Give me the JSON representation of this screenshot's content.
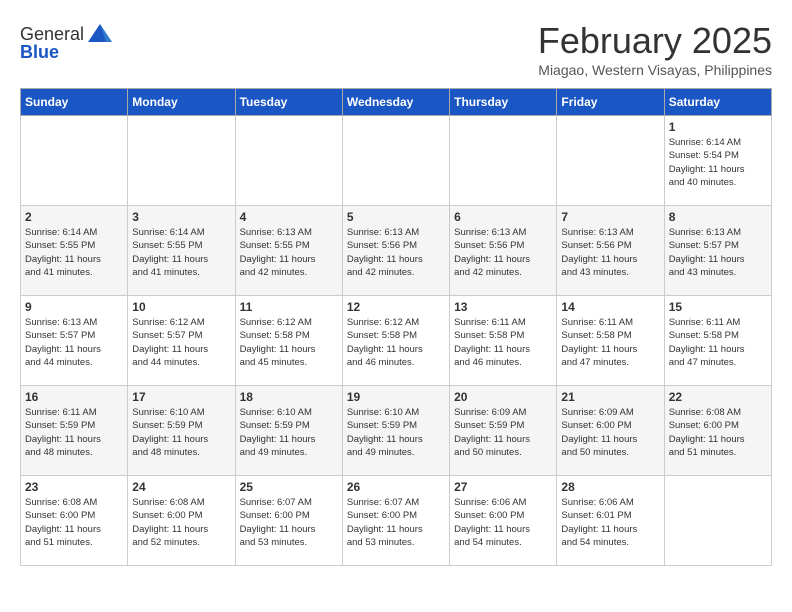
{
  "header": {
    "logo_general": "General",
    "logo_blue": "Blue",
    "title": "February 2025",
    "subtitle": "Miagao, Western Visayas, Philippines"
  },
  "weekdays": [
    "Sunday",
    "Monday",
    "Tuesday",
    "Wednesday",
    "Thursday",
    "Friday",
    "Saturday"
  ],
  "weeks": [
    [
      {
        "day": "",
        "info": ""
      },
      {
        "day": "",
        "info": ""
      },
      {
        "day": "",
        "info": ""
      },
      {
        "day": "",
        "info": ""
      },
      {
        "day": "",
        "info": ""
      },
      {
        "day": "",
        "info": ""
      },
      {
        "day": "1",
        "info": "Sunrise: 6:14 AM\nSunset: 5:54 PM\nDaylight: 11 hours\nand 40 minutes."
      }
    ],
    [
      {
        "day": "2",
        "info": "Sunrise: 6:14 AM\nSunset: 5:55 PM\nDaylight: 11 hours\nand 41 minutes."
      },
      {
        "day": "3",
        "info": "Sunrise: 6:14 AM\nSunset: 5:55 PM\nDaylight: 11 hours\nand 41 minutes."
      },
      {
        "day": "4",
        "info": "Sunrise: 6:13 AM\nSunset: 5:55 PM\nDaylight: 11 hours\nand 42 minutes."
      },
      {
        "day": "5",
        "info": "Sunrise: 6:13 AM\nSunset: 5:56 PM\nDaylight: 11 hours\nand 42 minutes."
      },
      {
        "day": "6",
        "info": "Sunrise: 6:13 AM\nSunset: 5:56 PM\nDaylight: 11 hours\nand 42 minutes."
      },
      {
        "day": "7",
        "info": "Sunrise: 6:13 AM\nSunset: 5:56 PM\nDaylight: 11 hours\nand 43 minutes."
      },
      {
        "day": "8",
        "info": "Sunrise: 6:13 AM\nSunset: 5:57 PM\nDaylight: 11 hours\nand 43 minutes."
      }
    ],
    [
      {
        "day": "9",
        "info": "Sunrise: 6:13 AM\nSunset: 5:57 PM\nDaylight: 11 hours\nand 44 minutes."
      },
      {
        "day": "10",
        "info": "Sunrise: 6:12 AM\nSunset: 5:57 PM\nDaylight: 11 hours\nand 44 minutes."
      },
      {
        "day": "11",
        "info": "Sunrise: 6:12 AM\nSunset: 5:58 PM\nDaylight: 11 hours\nand 45 minutes."
      },
      {
        "day": "12",
        "info": "Sunrise: 6:12 AM\nSunset: 5:58 PM\nDaylight: 11 hours\nand 46 minutes."
      },
      {
        "day": "13",
        "info": "Sunrise: 6:11 AM\nSunset: 5:58 PM\nDaylight: 11 hours\nand 46 minutes."
      },
      {
        "day": "14",
        "info": "Sunrise: 6:11 AM\nSunset: 5:58 PM\nDaylight: 11 hours\nand 47 minutes."
      },
      {
        "day": "15",
        "info": "Sunrise: 6:11 AM\nSunset: 5:58 PM\nDaylight: 11 hours\nand 47 minutes."
      }
    ],
    [
      {
        "day": "16",
        "info": "Sunrise: 6:11 AM\nSunset: 5:59 PM\nDaylight: 11 hours\nand 48 minutes."
      },
      {
        "day": "17",
        "info": "Sunrise: 6:10 AM\nSunset: 5:59 PM\nDaylight: 11 hours\nand 48 minutes."
      },
      {
        "day": "18",
        "info": "Sunrise: 6:10 AM\nSunset: 5:59 PM\nDaylight: 11 hours\nand 49 minutes."
      },
      {
        "day": "19",
        "info": "Sunrise: 6:10 AM\nSunset: 5:59 PM\nDaylight: 11 hours\nand 49 minutes."
      },
      {
        "day": "20",
        "info": "Sunrise: 6:09 AM\nSunset: 5:59 PM\nDaylight: 11 hours\nand 50 minutes."
      },
      {
        "day": "21",
        "info": "Sunrise: 6:09 AM\nSunset: 6:00 PM\nDaylight: 11 hours\nand 50 minutes."
      },
      {
        "day": "22",
        "info": "Sunrise: 6:08 AM\nSunset: 6:00 PM\nDaylight: 11 hours\nand 51 minutes."
      }
    ],
    [
      {
        "day": "23",
        "info": "Sunrise: 6:08 AM\nSunset: 6:00 PM\nDaylight: 11 hours\nand 51 minutes."
      },
      {
        "day": "24",
        "info": "Sunrise: 6:08 AM\nSunset: 6:00 PM\nDaylight: 11 hours\nand 52 minutes."
      },
      {
        "day": "25",
        "info": "Sunrise: 6:07 AM\nSunset: 6:00 PM\nDaylight: 11 hours\nand 53 minutes."
      },
      {
        "day": "26",
        "info": "Sunrise: 6:07 AM\nSunset: 6:00 PM\nDaylight: 11 hours\nand 53 minutes."
      },
      {
        "day": "27",
        "info": "Sunrise: 6:06 AM\nSunset: 6:00 PM\nDaylight: 11 hours\nand 54 minutes."
      },
      {
        "day": "28",
        "info": "Sunrise: 6:06 AM\nSunset: 6:01 PM\nDaylight: 11 hours\nand 54 minutes."
      },
      {
        "day": "",
        "info": ""
      }
    ]
  ]
}
